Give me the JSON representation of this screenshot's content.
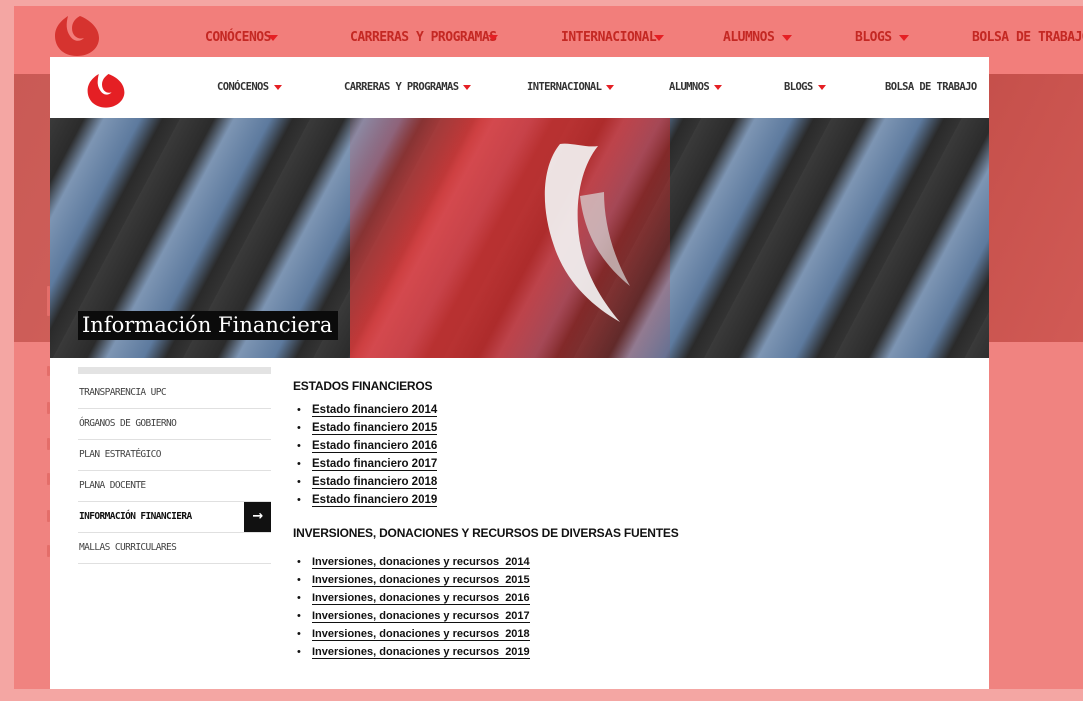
{
  "nav": {
    "items": [
      {
        "label": "CONÓCENOS",
        "has_dropdown": true
      },
      {
        "label": "CARRERAS Y PROGRAMAS",
        "has_dropdown": true
      },
      {
        "label": "INTERNACIONAL",
        "has_dropdown": true
      },
      {
        "label": "ALUMNOS",
        "has_dropdown": true
      },
      {
        "label": "BLOGS",
        "has_dropdown": true
      },
      {
        "label": "BOLSA DE TRABAJO",
        "has_dropdown": false
      }
    ]
  },
  "hero": {
    "title": "Información Financiera"
  },
  "sidebar": {
    "items": [
      {
        "label": "TRANSPARENCIA UPC",
        "active": false
      },
      {
        "label": "ÓRGANOS DE GOBIERNO",
        "active": false
      },
      {
        "label": "PLAN ESTRATÉGICO",
        "active": false
      },
      {
        "label": "PLANA DOCENTE",
        "active": false
      },
      {
        "label": "INFORMACIÓN FINANCIERA",
        "active": true,
        "icon": "arrow-right-icon"
      },
      {
        "label": "MALLAS CURRICULARES",
        "active": false
      }
    ]
  },
  "main": {
    "section1": {
      "title": "ESTADOS FINANCIEROS",
      "links": [
        "Estado financiero 2014",
        "Estado financiero 2015",
        "Estado financiero 2016",
        "Estado financiero 2017",
        "Estado financiero 2018",
        "Estado financiero 2019"
      ]
    },
    "section2": {
      "title": "INVERSIONES, DONACIONES Y RECURSOS DE DIVERSAS FUENTES",
      "links": [
        "Inversiones, donaciones y recursos  2014",
        "Inversiones, donaciones y recursos  2015",
        "Inversiones, donaciones y recursos  2016",
        "Inversiones, donaciones y recursos  2017",
        "Inversiones, donaciones y recursos  2018",
        "Inversiones, donaciones y recursos  2019"
      ]
    }
  },
  "colors": {
    "brand_red": "#e51f24",
    "overlay_pink": "#f27e7b",
    "text_dark": "#111111"
  }
}
